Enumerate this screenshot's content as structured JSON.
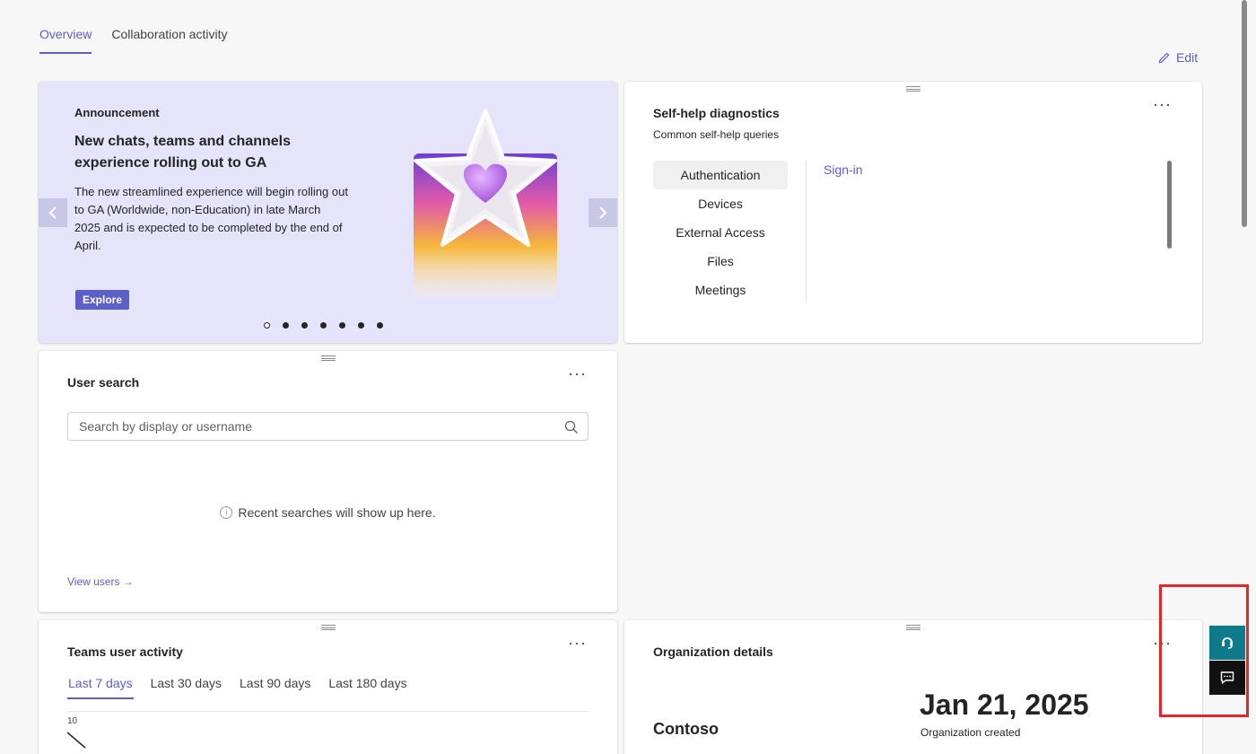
{
  "tabs": [
    {
      "label": "Overview"
    },
    {
      "label": "Collaboration activity"
    }
  ],
  "edit_label": "Edit",
  "announcement": {
    "label": "Announcement",
    "headline": "New chats, teams and channels experience rolling out to GA",
    "body": "The new streamlined experience will begin rolling out to GA (Worldwide, non-Education) in late March 2025 and is expected to be completed by the end of April.",
    "button": "Explore",
    "dot_count": 7,
    "active_dot": 0
  },
  "self_help": {
    "title": "Self-help diagnostics",
    "subtitle": "Common self-help queries",
    "more": "···",
    "categories": [
      {
        "label": "Authentication"
      },
      {
        "label": "Devices"
      },
      {
        "label": "External Access"
      },
      {
        "label": "Files"
      },
      {
        "label": "Meetings"
      }
    ],
    "selected_link": "Sign-in"
  },
  "user_search": {
    "title": "User search",
    "more": "···",
    "placeholder": "Search by display or username",
    "recent_text": "Recent searches will show up here.",
    "info_glyph": "i",
    "view_users": "View users →"
  },
  "teams_activity": {
    "title": "Teams user activity",
    "more": "···",
    "periods": [
      {
        "label": "Last 7 days"
      },
      {
        "label": "Last 30 days"
      },
      {
        "label": "Last 90 days"
      },
      {
        "label": "Last 180 days"
      }
    ],
    "y_tick": "10"
  },
  "org_details": {
    "title": "Organization details",
    "more": "···",
    "name": "Contoso",
    "created_date": "Jan 21, 2025",
    "created_label": "Organization created"
  },
  "colors": {
    "accent": "#5b5fc7",
    "support_button": "#0e7a8a",
    "feedback_button": "#111111",
    "highlight_box": "#e8252d"
  },
  "icons": {
    "edit": "pencil-icon",
    "prev": "chevron-left-icon",
    "next": "chevron-right-icon",
    "search": "search-icon",
    "info": "info-icon",
    "support": "headset-icon",
    "feedback": "feedback-icon"
  }
}
